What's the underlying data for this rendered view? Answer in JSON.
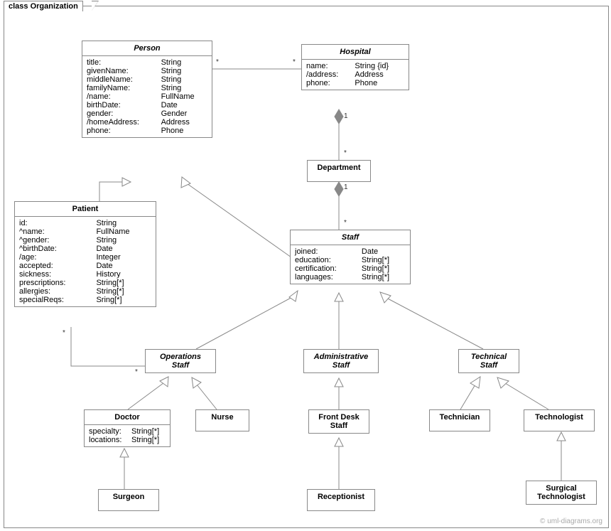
{
  "frame_title": "class Organization",
  "watermark": "© uml-diagrams.org",
  "classes": {
    "person": {
      "name": "Person",
      "attrs": [
        [
          "title:",
          "String"
        ],
        [
          "givenName:",
          "String"
        ],
        [
          "middleName:",
          "String"
        ],
        [
          "familyName:",
          "String"
        ],
        [
          "/name:",
          "FullName"
        ],
        [
          "birthDate:",
          "Date"
        ],
        [
          "gender:",
          "Gender"
        ],
        [
          "/homeAddress:",
          "Address"
        ],
        [
          "phone:",
          "Phone"
        ]
      ]
    },
    "hospital": {
      "name": "Hospital",
      "attrs": [
        [
          "name:",
          "String {id}"
        ],
        [
          "/address:",
          "Address"
        ],
        [
          "phone:",
          "Phone"
        ]
      ]
    },
    "department": {
      "name": "Department"
    },
    "patient": {
      "name": "Patient",
      "attrs": [
        [
          "id:",
          "String"
        ],
        [
          "^name:",
          "FullName"
        ],
        [
          "^gender:",
          "String"
        ],
        [
          "^birthDate:",
          "Date"
        ],
        [
          "/age:",
          "Integer"
        ],
        [
          "accepted:",
          "Date"
        ],
        [
          "sickness:",
          "History"
        ],
        [
          "prescriptions:",
          "String[*]"
        ],
        [
          "allergies:",
          "String[*]"
        ],
        [
          "specialReqs:",
          "Sring[*]"
        ]
      ]
    },
    "staff": {
      "name": "Staff",
      "attrs": [
        [
          "joined:",
          "Date"
        ],
        [
          "education:",
          "String[*]"
        ],
        [
          "certification:",
          "String[*]"
        ],
        [
          "languages:",
          "String[*]"
        ]
      ]
    },
    "opsStaff": {
      "name": "Operations\nStaff"
    },
    "adminStaff": {
      "name": "Administrative\nStaff"
    },
    "techStaff": {
      "name": "Technical\nStaff"
    },
    "doctor": {
      "name": "Doctor",
      "attrs": [
        [
          "specialty:",
          "String[*]"
        ],
        [
          "locations:",
          "String[*]"
        ]
      ]
    },
    "nurse": {
      "name": "Nurse"
    },
    "frontDesk": {
      "name": "Front Desk\nStaff"
    },
    "receptionist": {
      "name": "Receptionist"
    },
    "technician": {
      "name": "Technician"
    },
    "technologist": {
      "name": "Technologist"
    },
    "surgTech": {
      "name": "Surgical\nTechnologist"
    },
    "surgeon": {
      "name": "Surgeon"
    }
  },
  "mults": {
    "m1": "*",
    "m2": "*",
    "m3": "1",
    "m4": "*",
    "m5": "1",
    "m6": "*",
    "m7": "*",
    "m8": "*"
  }
}
